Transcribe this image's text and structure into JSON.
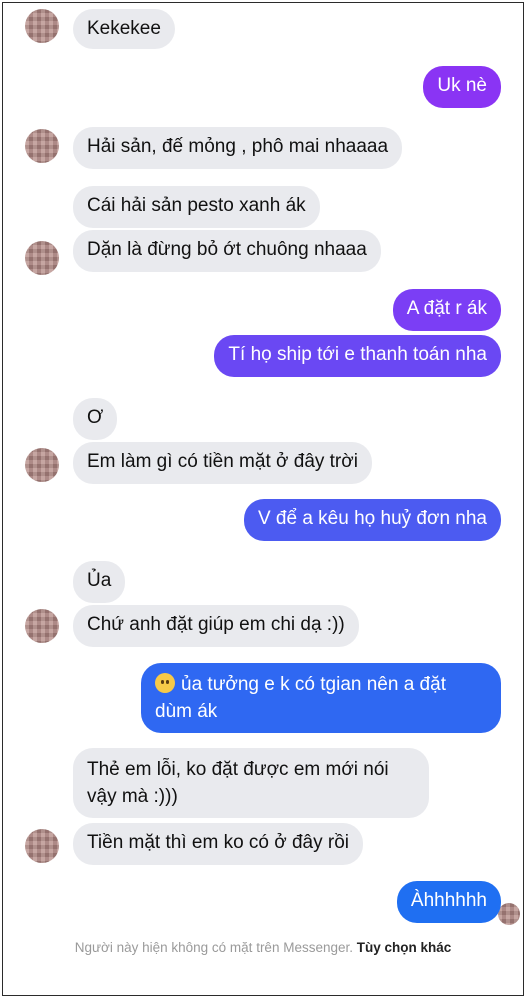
{
  "messages": [
    {
      "text": "Kekekee",
      "side": "in"
    },
    {
      "text": "Uk nè",
      "side": "out"
    },
    {
      "text": "Hải sản, đế mỏng , phô mai nhaaaa",
      "side": "in"
    },
    {
      "text": "Cái hải sản pesto xanh ák",
      "side": "in"
    },
    {
      "text": "Dặn là đừng bỏ ớt chuông nhaaa",
      "side": "in"
    },
    {
      "text": "A đặt r ák",
      "side": "out"
    },
    {
      "text": "Tí họ ship tới e thanh toán nha",
      "side": "out"
    },
    {
      "text": "Ơ",
      "side": "in"
    },
    {
      "text": "Em làm gì có tiền mặt ở đây trời",
      "side": "in"
    },
    {
      "text": "V để a kêu họ huỷ đơn nha",
      "side": "out"
    },
    {
      "text": "Ủa",
      "side": "in"
    },
    {
      "text": "Chứ anh đặt giúp em chi dạ :))",
      "side": "in"
    },
    {
      "line1": "ủa tưởng e k có tgian nên a đặt",
      "line2": "dùm ák",
      "emoji": "sad-face-emoji",
      "side": "out"
    },
    {
      "line1": "Thẻ em lỗi, ko đặt được em mới nói",
      "line2": "vậy mà :)))",
      "side": "in"
    },
    {
      "text": "Tiền mặt thì em ko có ở đây rồi",
      "side": "in"
    },
    {
      "text": "Àhhhhhh",
      "side": "out"
    }
  ],
  "footer": {
    "status": "Người này hiện không có mặt trên Messenger.",
    "link": "Tùy chọn khác"
  },
  "colors": {
    "incoming_bubble": "#e9eaee",
    "outgoing_top": "#8a34f4",
    "outgoing_mid": "#5b4df0",
    "outgoing_bottom": "#1f6ff2"
  }
}
